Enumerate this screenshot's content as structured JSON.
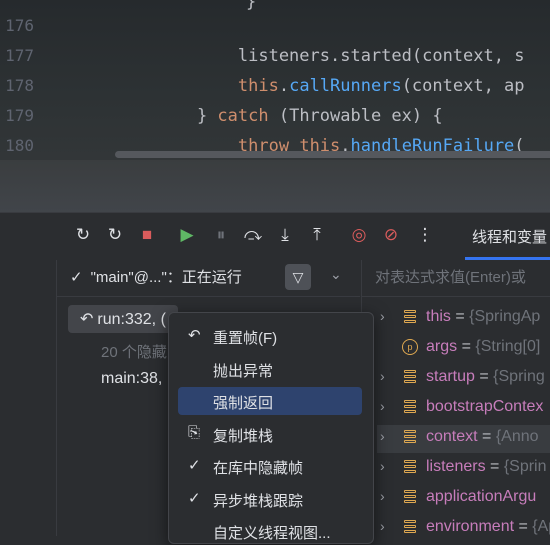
{
  "editor": {
    "line_numbers": [
      "176",
      "177",
      "178",
      "179",
      "180"
    ],
    "top_fragment": "}",
    "lines": [
      {
        "parts": [
          {
            "t": "",
            "k": ""
          }
        ]
      },
      {
        "parts": [
          {
            "t": "        listeners.started(context, s",
            "k": ""
          }
        ]
      },
      {
        "parts": [
          {
            "t": "        ",
            "k": ""
          },
          {
            "t": "this",
            "k": "kw"
          },
          {
            "t": ".",
            "k": ""
          },
          {
            "t": "callRunners",
            "k": "fn"
          },
          {
            "t": "(context, ap",
            "k": ""
          }
        ]
      },
      {
        "parts": [
          {
            "t": "    } ",
            "k": ""
          },
          {
            "t": "catch",
            "k": "kw"
          },
          {
            "t": " (Throwable ex) {",
            "k": ""
          }
        ]
      },
      {
        "parts": [
          {
            "t": "        ",
            "k": ""
          },
          {
            "t": "throw",
            "k": "kw"
          },
          {
            "t": " ",
            "k": ""
          },
          {
            "t": "this",
            "k": "kw"
          },
          {
            "t": ".",
            "k": ""
          },
          {
            "t": "handleRunFailure",
            "k": "fn"
          },
          {
            "t": "(",
            "k": ""
          }
        ]
      }
    ]
  },
  "debug_toolbar": {
    "buttons": [
      {
        "name": "rerun-icon",
        "glyph": "↻",
        "color": "#dfe1e5"
      },
      {
        "name": "rerun-config-icon",
        "glyph": "↻",
        "color": "#dfe1e5"
      },
      {
        "name": "stop-icon",
        "glyph": "■",
        "color": "#db5c5c"
      },
      {
        "name": "resume-icon",
        "glyph": "▶",
        "color": "#5fb865"
      },
      {
        "name": "pause-icon",
        "glyph": "⏸",
        "color": "#6f737a"
      },
      {
        "name": "step-over-icon",
        "glyph": "⤼",
        "color": "#dfe1e5"
      },
      {
        "name": "step-into-icon",
        "glyph": "⤓",
        "color": "#dfe1e5"
      },
      {
        "name": "step-out-icon",
        "glyph": "⤒",
        "color": "#dfe1e5"
      },
      {
        "name": "view-breakpoints-icon",
        "glyph": "◎",
        "color": "#db5c5c"
      },
      {
        "name": "mute-breakpoints-icon",
        "glyph": "⊘",
        "color": "#db5c5c"
      },
      {
        "name": "more-icon",
        "glyph": "⋮",
        "color": "#dfe1e5"
      }
    ],
    "threads_tab_label": "线程和变量"
  },
  "frames": {
    "thread_selector": "\"main\"@...\"：正在运行",
    "current_frame": "run:332, (",
    "hidden_frames": "20 个隐藏",
    "main_frame": "main:38, "
  },
  "variables": {
    "eval_placeholder": "对表达式求值(Enter)或",
    "items": [
      {
        "name": "this",
        "value": "{SpringAp",
        "icon": "field",
        "expandable": true
      },
      {
        "name": "args",
        "value": "{String[0]",
        "icon": "param",
        "expandable": false
      },
      {
        "name": "startup",
        "value": "{Spring",
        "icon": "field",
        "expandable": true
      },
      {
        "name": "bootstrapContex",
        "value": "",
        "icon": "field",
        "expandable": true
      },
      {
        "name": "context",
        "value": "{Anno",
        "icon": "field",
        "expandable": true
      },
      {
        "name": "listeners",
        "value": "{Sprin",
        "icon": "field",
        "expandable": true
      },
      {
        "name": "applicationArgu",
        "value": "",
        "icon": "field",
        "expandable": true
      },
      {
        "name": "environment",
        "value": "{App",
        "icon": "field",
        "expandable": true
      }
    ]
  },
  "context_menu": {
    "items": [
      {
        "label": "重置帧(F)",
        "icon": "reset-frame-icon",
        "glyph": "↶"
      },
      {
        "label": "抛出异常",
        "icon": "",
        "glyph": ""
      },
      {
        "label": "强制返回",
        "icon": "",
        "glyph": ""
      },
      {
        "label": "复制堆栈",
        "icon": "copy-icon",
        "glyph": "⎘"
      },
      {
        "label": "在库中隐藏帧",
        "icon": "check-icon",
        "glyph": "✓"
      },
      {
        "label": "异步堆栈跟踪",
        "icon": "check-icon",
        "glyph": "✓"
      },
      {
        "label": "自定义线程视图...",
        "icon": "",
        "glyph": ""
      }
    ],
    "highlighted_index": 2
  }
}
